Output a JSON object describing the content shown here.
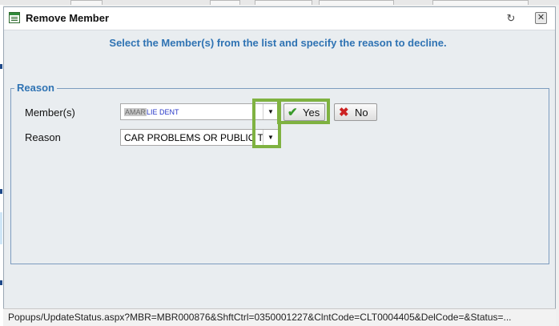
{
  "dialog": {
    "title": "Remove Member",
    "icon": "form-window-icon",
    "refresh_icon": "refresh-icon",
    "close_icon": "close-icon",
    "instruction": "Select the Member(s) from the list and specify the reason to decline."
  },
  "reason_group": {
    "legend": "Reason",
    "member_label": "Member(s)",
    "member_value_redacted": "AMAR",
    "member_value_visible": "LIE DENT",
    "reason_label": "Reason",
    "reason_value": "CAR PROBLEMS OR PUBLIC TR"
  },
  "buttons": {
    "yes_label": "Yes",
    "yes_icon": "checkmark-icon",
    "no_label": "No",
    "no_icon": "x-icon"
  },
  "colors": {
    "accent_blue": "#2f73b3",
    "highlight_green": "#7fb241",
    "yes_check": "#3a9a2a",
    "no_x": "#cc2222"
  },
  "status_bar": {
    "text": "Popups/UpdateStatus.aspx?MBR=MBR000876&ShftCtrl=0350001227&ClntCode=CLT0004405&DelCode=&Status=..."
  }
}
